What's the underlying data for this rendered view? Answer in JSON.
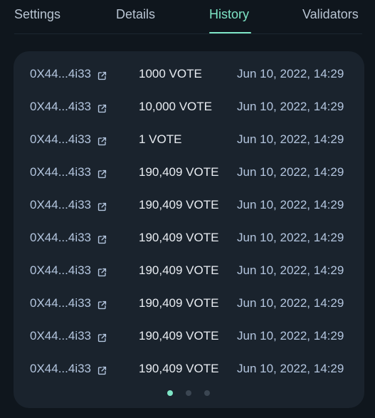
{
  "tabs": [
    {
      "label": "Settings",
      "active": false
    },
    {
      "label": "Details",
      "active": false
    },
    {
      "label": "History",
      "active": true
    },
    {
      "label": "Validators",
      "active": false
    }
  ],
  "colors": {
    "accent": "#7ee5c6",
    "card_bg": "#1a232d",
    "page_bg": "#0f161d",
    "muted_text": "#b3c5de"
  },
  "history": {
    "rows": [
      {
        "address": "0X44...4i33",
        "amount": "1000 VOTE",
        "date": "Jun 10, 2022, 14:29"
      },
      {
        "address": "0X44...4i33",
        "amount": "10,000 VOTE",
        "date": "Jun 10, 2022, 14:29"
      },
      {
        "address": "0X44...4i33",
        "amount": "1 VOTE",
        "date": "Jun 10, 2022, 14:29"
      },
      {
        "address": "0X44...4i33",
        "amount": "190,409 VOTE",
        "date": "Jun 10, 2022, 14:29"
      },
      {
        "address": "0X44...4i33",
        "amount": "190,409 VOTE",
        "date": "Jun 10, 2022, 14:29"
      },
      {
        "address": "0X44...4i33",
        "amount": "190,409 VOTE",
        "date": "Jun 10, 2022, 14:29"
      },
      {
        "address": "0X44...4i33",
        "amount": "190,409 VOTE",
        "date": "Jun 10, 2022, 14:29"
      },
      {
        "address": "0X44...4i33",
        "amount": "190,409 VOTE",
        "date": "Jun 10, 2022, 14:29"
      },
      {
        "address": "0X44...4i33",
        "amount": "190,409 VOTE",
        "date": "Jun 10, 2022, 14:29"
      },
      {
        "address": "0X44...4i33",
        "amount": "190,409 VOTE",
        "date": "Jun 10, 2022, 14:29"
      }
    ],
    "address_icon": "external-link-icon"
  },
  "pagination": {
    "pages": 3,
    "current": 1
  }
}
